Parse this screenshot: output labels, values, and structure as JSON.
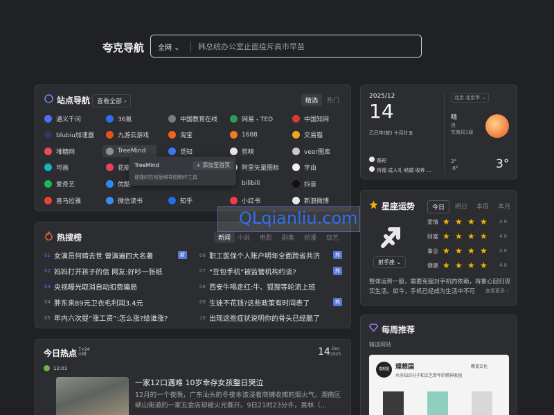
{
  "header": {
    "brand": "夸克导航",
    "scope": "全网",
    "search_placeholder": "韩总统办公室止面疫斥高市早苗"
  },
  "sites_card": {
    "title": "站点导航",
    "view_all": "查看全部 ›",
    "tab_active": "精选",
    "tab_inactive": "热门",
    "sites": [
      {
        "label": "通义千问",
        "color": "#4f6ef7"
      },
      {
        "label": "36氪",
        "color": "#2f6fe8"
      },
      {
        "label": "中国教育在线",
        "color": "#7a7c80"
      },
      {
        "label": "网易 - TED",
        "color": "#2f9a55"
      },
      {
        "label": "中国知网",
        "color": "#d83a2e"
      },
      {
        "label": "blubiu加速器",
        "color": "#2e3a5a"
      },
      {
        "label": "九游云游戏",
        "color": "#e2531f"
      },
      {
        "label": "淘宝",
        "color": "#f5621d"
      },
      {
        "label": "1688",
        "color": "#f07c1d"
      },
      {
        "label": "交易猫",
        "color": "#f3a31c"
      },
      {
        "label": "堆糖网",
        "color": "#e84d5d"
      },
      {
        "label": "TreeMind",
        "color": "#8e8f94"
      },
      {
        "label": "觅知",
        "color": "#3a7cf0"
      },
      {
        "label": "剪映",
        "color": "#e8e8ea"
      },
      {
        "label": "veer图库",
        "color": "#c9c9cc"
      },
      {
        "label": "可画",
        "color": "#14b5c2"
      },
      {
        "label": "花瓣",
        "color": "#e8435a"
      },
      {
        "label": "",
        "color": "#2b2d31"
      },
      {
        "label": "阿里矢量图标",
        "color": "#e8e8ea"
      },
      {
        "label": "字由",
        "color": "#f0f0f2"
      },
      {
        "label": "爱奇艺",
        "color": "#19b955"
      },
      {
        "label": "优酷",
        "color": "#2b8cf0"
      },
      {
        "label": "",
        "color": "#2b2d31"
      },
      {
        "label": "bilibili",
        "color": "#2b2d31"
      },
      {
        "label": "抖音",
        "color": "#111"
      },
      {
        "label": "喜马拉雅",
        "color": "#e8432f"
      },
      {
        "label": "微信读书",
        "color": "#3a8af0"
      },
      {
        "label": "知乎",
        "color": "#1f6fe8"
      },
      {
        "label": "小红书",
        "color": "#ef3b4a"
      },
      {
        "label": "新浪微博",
        "color": "#e8e8ea"
      }
    ],
    "tooltip": {
      "name": "TreeMind",
      "add": "+ 添加至首页",
      "desc": "便捷的在线思维导图制作工具"
    }
  },
  "hot_card": {
    "title": "热搜榜",
    "tabs": [
      "新闻",
      "小说",
      "电影",
      "剧集",
      "动漫",
      "综艺"
    ],
    "items": [
      {
        "num": "01",
        "text": "女演员何晴去世 曾演遍四大名著",
        "badge": "新"
      },
      {
        "num": "02",
        "text": "妈妈打开孩子的信 网友:好吵一张纸",
        "badge": ""
      },
      {
        "num": "03",
        "text": "央视曝光取消自动扣费骗局",
        "badge": ""
      },
      {
        "num": "04",
        "text": "胖东来89元卫衣毛利润3.4元",
        "badge": ""
      },
      {
        "num": "05",
        "text": "年内六次提“涨工资”:怎么涨?给谁涨?",
        "badge": ""
      },
      {
        "num": "06",
        "text": "职工医保个人账户明年全面跨省共济",
        "badge": "热"
      },
      {
        "num": "07",
        "text": "“豆包手机”被监管机构约谈?",
        "badge": "热"
      },
      {
        "num": "08",
        "text": "西安牛喝走红:牛、狐狸等轮流上班",
        "badge": ""
      },
      {
        "num": "09",
        "text": "生娃不花钱?这些政策有时间表了",
        "badge": "热"
      },
      {
        "num": "10",
        "text": "出现这些症状说明你的骨头已经脆了",
        "badge": ""
      }
    ]
  },
  "news_card": {
    "brand": "今日热点",
    "brand_sub": "7×24 小时",
    "date_day": "14",
    "date_month": "Dec",
    "date_year": "2025",
    "time": "12:01",
    "headline": "一家12口遇难 10岁幸存女孩整日哭泣",
    "body": "12月的一个夜晚，广东汕头的冬夜本该浸着商铺收摊的烟火气，潮南区峡山街道的一家五金店却被火光撕开。9日21时23分许，吴林（..."
  },
  "calendar": {
    "ym": "2025/12",
    "day": "14",
    "lunar": "乙巳年(蛇) 十月廿五",
    "ji": "祭祀",
    "yi": "祈福 成人礼 结婚 收养 ...",
    "city": "北京 北京市",
    "weather": "晴",
    "aqi": "良",
    "wind": "东南风1级",
    "temp_hi": "3°",
    "temp_lo": "-6°",
    "temp_now": "3°"
  },
  "horoscope": {
    "title": "星座运势",
    "tabs": [
      "今日",
      "明日",
      "本周",
      "本月"
    ],
    "sign": "射手座",
    "ratings": [
      {
        "label": "爱情",
        "score": "4.0"
      },
      {
        "label": "财富",
        "score": "4.0"
      },
      {
        "label": "事业",
        "score": "4.0"
      },
      {
        "label": "健康",
        "score": "4.0"
      }
    ],
    "text": "整体运势一般，需要克服对手机的依赖，将重心回归现实生活。如今，手机已经成为生活中不可",
    "more": "查看更多 ›"
  },
  "weekly": {
    "title": "每周推荐",
    "sub": "精选网站",
    "site": "理想国",
    "site_tag": "教育文化",
    "site_desc": "众多知识分子和文艺青年的精神家园"
  },
  "watermark": "QLqianliu.com"
}
